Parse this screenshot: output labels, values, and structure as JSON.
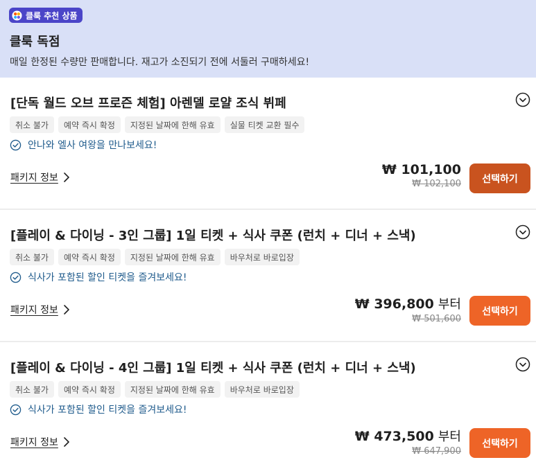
{
  "promo": {
    "badge_label": "클룩 추천 상품",
    "badge_icon": "klook-logo-icon",
    "title": "클룩 독점",
    "subtitle": "매일 한정된 수량만 판매합니다. 재고가 소진되기 전에 서둘러 구매하세요!"
  },
  "colors": {
    "promo_bg": "#d9e0f7",
    "badge_bg": "#4b45c8",
    "button_bg": "#ee6427",
    "button_active_bg": "#c9531f",
    "highlight_text": "#1f5b8c"
  },
  "products": [
    {
      "title": "[단독 월드 오브 프로즌 체험] 아렌델 로얄 조식 뷔페",
      "tags": [
        "취소 불가",
        "예약 즉시 확정",
        "지정된 날짜에 한해 유효",
        "실물 티켓 교환 필수"
      ],
      "highlight": "안나와 엘사 여왕을 만나보세요!",
      "package_link": "패키지 정보",
      "price": "₩ 101,100",
      "price_suffix": "",
      "original_price": "₩ 102,100",
      "button_label": "선택하기"
    },
    {
      "title": "[플레이 & 다이닝 - 3인 그룹] 1일 티켓 + 식사 쿠폰 (런치 + 디너 + 스낵)",
      "tags": [
        "취소 불가",
        "예약 즉시 확정",
        "지정된 날짜에 한해 유효",
        "바우처로 바로입장"
      ],
      "highlight": "식사가 포함된 할인 티켓을 즐겨보세요!",
      "package_link": "패키지 정보",
      "price": "₩ 396,800",
      "price_suffix": "부터",
      "original_price": "₩ 501,600",
      "button_label": "선택하기"
    },
    {
      "title": "[플레이 & 다이닝 - 4인 그룹] 1일 티켓 + 식사 쿠폰 (런치 + 디너 + 스낵)",
      "tags": [
        "취소 불가",
        "예약 즉시 확정",
        "지정된 날짜에 한해 유효",
        "바우처로 바로입장"
      ],
      "highlight": "식사가 포함된 할인 티켓을 즐겨보세요!",
      "package_link": "패키지 정보",
      "price": "₩ 473,500",
      "price_suffix": "부터",
      "original_price": "₩ 647,900",
      "button_label": "선택하기"
    }
  ]
}
